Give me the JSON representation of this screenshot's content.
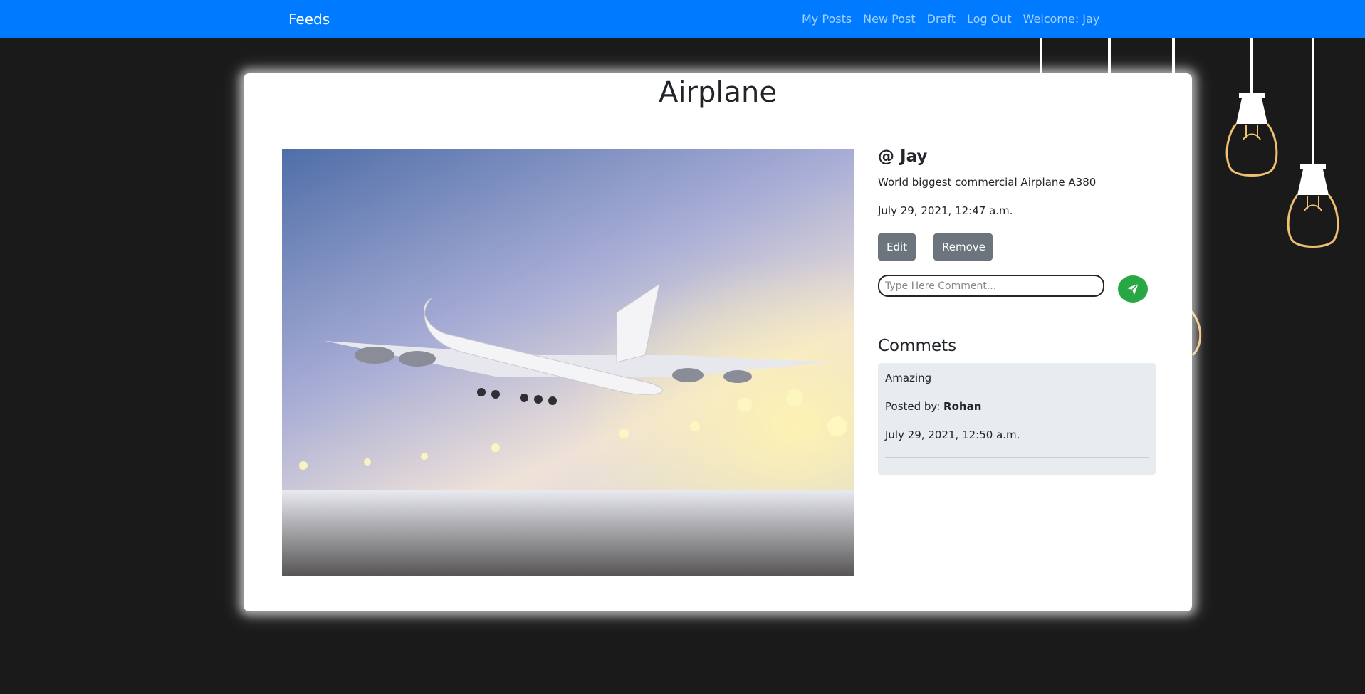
{
  "navbar": {
    "brand": "Feeds",
    "links": [
      "My Posts",
      "New Post",
      "Draft",
      "Log Out",
      "Welcome: Jay"
    ],
    "color": "#007bff"
  },
  "post": {
    "title": "Airplane",
    "author": "@ Jay",
    "description": "World biggest commercial Airplane A380",
    "date": "July 29, 2021, 12:47 a.m.",
    "edit_label": "Edit",
    "remove_label": "Remove"
  },
  "comment_form": {
    "placeholder": "Type Here Comment...",
    "send_icon": "send-icon"
  },
  "comments": {
    "title": "Commets",
    "items": [
      {
        "text": "Amazing",
        "posted_by_label": "Posted by:",
        "posted_by": "Rohan",
        "date": "July 29, 2021, 12:50 a.m."
      }
    ]
  },
  "colors": {
    "background": "#1a1a1a",
    "accent_green": "#28a745",
    "button_gray": "#6c757d",
    "bulb_outline": "#f0c070"
  }
}
